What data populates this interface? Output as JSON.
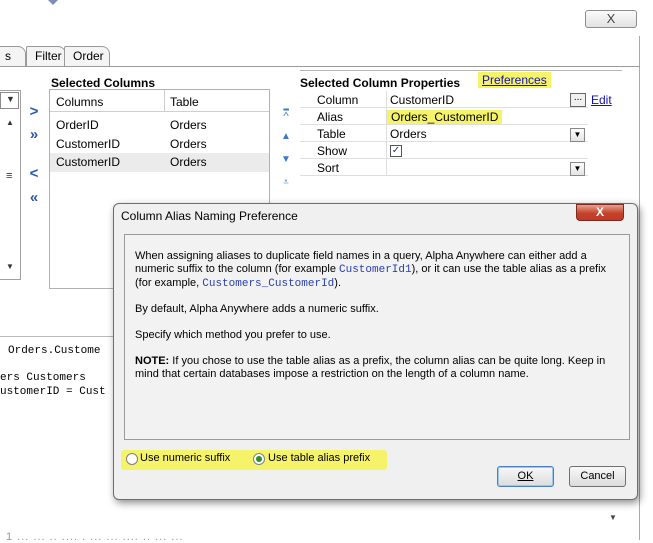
{
  "background_window": {
    "close_label": "X",
    "tabs": [
      "s",
      "Filter",
      "Order"
    ],
    "selected_columns": {
      "title": "Selected Columns",
      "headers": [
        "Columns",
        "Table"
      ],
      "rows": [
        {
          "column": "OrderID",
          "table": "Orders"
        },
        {
          "column": "CustomerID",
          "table": "Orders"
        },
        {
          "column": "CustomerID",
          "table": "Orders"
        }
      ]
    },
    "move_buttons": [
      ">",
      "»",
      "<",
      "«"
    ],
    "properties": {
      "title": "Selected Column Properties",
      "preferences_link": "Preferences",
      "edit_link": "Edit",
      "rows": [
        {
          "label": "Column",
          "value": "CustomerID"
        },
        {
          "label": "Alias",
          "value": "Orders_CustomerID"
        },
        {
          "label": "Table",
          "value": "Orders"
        },
        {
          "label": "Show",
          "value": ""
        },
        {
          "label": "Sort",
          "value": ""
        }
      ]
    },
    "sql": {
      "line1": "Orders.Custome",
      "line2": "ers Customers",
      "line3": "ustomerID = Cust"
    },
    "bottom_text": "1  ...  ...  ..  ....  .  ...  ...  ....  ..  ...  ..."
  },
  "dialog": {
    "title": "Column Alias Naming Preference",
    "close_label": "X",
    "para1_a": "When assigning aliases to duplicate field names in a query, Alpha Anywhere can either add a numeric suffix to the column (for example ",
    "para1_code1": "CustomerId1",
    "para1_b": "), or it can use the table alias as a prefix (for example, ",
    "para1_code2": "Customers_CustomerId",
    "para1_c": ").",
    "para2": "By default, Alpha Anywhere adds a numeric suffix.",
    "para3": "Specify which method you prefer to use.",
    "note_label": "NOTE:",
    "note_text": " If you chose to use the table alias as a prefix, the column alias can be quite long. Keep in mind that certain databases impose a restriction on the length of a column name.",
    "option_numeric": "Use numeric suffix",
    "option_prefix": "Use table alias prefix",
    "selected_option": "Use table alias prefix",
    "ok_label": "OK",
    "cancel_label": "Cancel"
  },
  "colors": {
    "highlight": "#f5f36a",
    "link": "#1111aa",
    "code": "#2a3fb0",
    "close_red": "#c4432b"
  }
}
